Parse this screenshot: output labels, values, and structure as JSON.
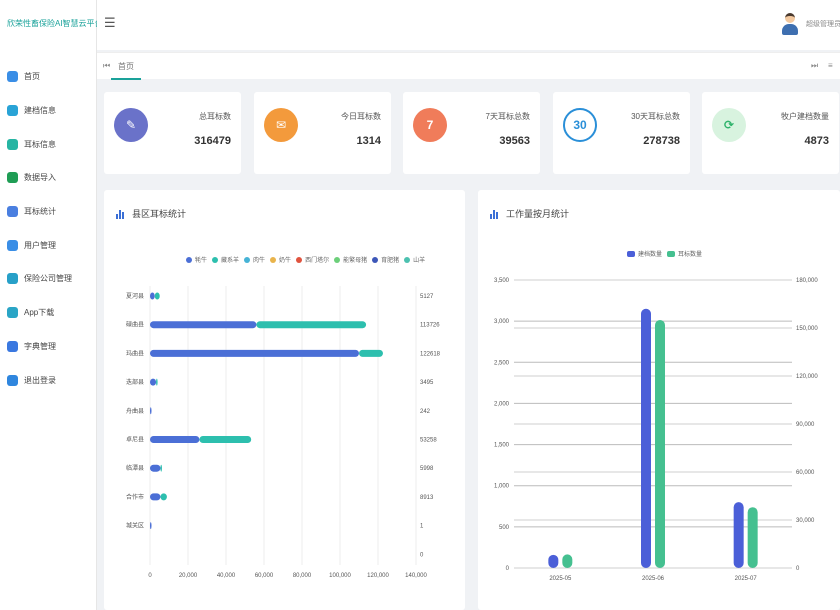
{
  "app": {
    "title": "欣荣性畜保险AI智慧云平台"
  },
  "sidebar": {
    "items": [
      {
        "label": "首页",
        "icon": "home-icon",
        "color": "#3a8ee6"
      },
      {
        "label": "建档信息",
        "icon": "file-icon",
        "color": "#29a3d6"
      },
      {
        "label": "耳标信息",
        "icon": "tag-icon",
        "color": "#27b5a3"
      },
      {
        "label": "数据导入",
        "icon": "excel-icon",
        "color": "#1f9d55"
      },
      {
        "label": "耳标统计",
        "icon": "bar-chart-icon",
        "color": "#4a7fe0"
      },
      {
        "label": "用户管理",
        "icon": "user-icon",
        "color": "#3a8ee6"
      },
      {
        "label": "保险公司管理",
        "icon": "shield-icon",
        "color": "#27a0c8"
      },
      {
        "label": "App下载",
        "icon": "app-icon",
        "color": "#2aa5c6"
      },
      {
        "label": "字典管理",
        "icon": "book-icon",
        "color": "#3a78e0"
      },
      {
        "label": "退出登录",
        "icon": "logout-icon",
        "color": "#2f86de"
      }
    ]
  },
  "header": {
    "menu_toggle": "☰",
    "user_name": "超级管理员"
  },
  "tabs": {
    "home": "首页",
    "left_arrow": "⏮",
    "right_arrow": "⏭",
    "more": "≡"
  },
  "stats": [
    {
      "label": "总耳标数",
      "value": "316479",
      "icon": "✎",
      "color": "#6a72c9",
      "ring": ""
    },
    {
      "label": "今日耳标数",
      "value": "1314",
      "icon": "✉",
      "color": "#f39a3c",
      "ring": ""
    },
    {
      "label": "7天耳标总数",
      "value": "39563",
      "icon": "7",
      "color": "#f07c5a",
      "ring": ""
    },
    {
      "label": "30天耳标总数",
      "value": "278738",
      "icon": "30",
      "color": "#ffffff",
      "ring": "#2a8fd8"
    },
    {
      "label": "牧户建档数量",
      "value": "4873",
      "icon": "⟳",
      "color": "#d8f3df",
      "ring": ""
    }
  ],
  "region_panel": {
    "title": "县区耳标统计"
  },
  "monthly_panel": {
    "title": "工作量按月统计"
  },
  "chart_data": [
    {
      "type": "bar",
      "orientation": "horizontal",
      "stacked": true,
      "categories": [
        "夏河县",
        "碌曲县",
        "玛曲县",
        "迭部县",
        "舟曲县",
        "卓尼县",
        "临潭县",
        "合作市",
        "城关区"
      ],
      "totals": [
        "5127",
        "113726",
        "122618",
        "3495",
        "242",
        "53258",
        "5998",
        "8913",
        "1",
        "0"
      ],
      "series": [
        {
          "name": "牦牛",
          "color": "#4b6fd6",
          "values": [
            2500,
            56000,
            110000,
            3200,
            242,
            26000,
            5500,
            5500,
            1
          ]
        },
        {
          "name": "藏系羊",
          "color": "#2dbfae",
          "values": [
            2627,
            57726,
            12618,
            295,
            0,
            27258,
            498,
            3413,
            0
          ]
        },
        {
          "name": "肉牛",
          "color": "#46b3d6",
          "values": [
            0,
            0,
            0,
            0,
            0,
            0,
            0,
            0,
            0
          ]
        },
        {
          "name": "奶牛",
          "color": "#e9b44c",
          "values": [
            0,
            0,
            0,
            0,
            0,
            0,
            0,
            0,
            0
          ]
        },
        {
          "name": "西门塔尔",
          "color": "#e0533e",
          "values": [
            0,
            0,
            0,
            0,
            0,
            0,
            0,
            0,
            0
          ]
        },
        {
          "name": "能繁母猪",
          "color": "#6ccf7a",
          "values": [
            0,
            0,
            0,
            0,
            0,
            0,
            0,
            0,
            0
          ]
        },
        {
          "name": "育肥猪",
          "color": "#3d57b8",
          "values": [
            0,
            0,
            0,
            0,
            0,
            0,
            0,
            0,
            0
          ]
        },
        {
          "name": "山羊",
          "color": "#4cc1b0",
          "values": [
            0,
            0,
            0,
            0,
            0,
            0,
            0,
            0,
            0
          ]
        }
      ],
      "xlim": [
        0,
        140000
      ],
      "xticks": [
        "0",
        "20,000",
        "40,000",
        "60,000",
        "80,000",
        "100,000",
        "120,000",
        "140,000"
      ],
      "legend": "top",
      "grid": true
    },
    {
      "type": "bar",
      "categories": [
        "2025-05",
        "2025-06",
        "2025-07"
      ],
      "series": [
        {
          "name": "建档数量",
          "color": "#4b5fd8",
          "axis": "left",
          "values": [
            160,
            3150,
            800
          ]
        },
        {
          "name": "耳标数量",
          "color": "#45c090",
          "axis": "right",
          "values": [
            8500,
            155000,
            38000
          ]
        }
      ],
      "ylim_left": [
        0,
        3500
      ],
      "ylim_right": [
        0,
        180000
      ],
      "yticks_left": [
        "0",
        "500",
        "1,000",
        "1,500",
        "2,000",
        "2,500",
        "3,000",
        "3,500"
      ],
      "yticks_right": [
        "0",
        "30,000",
        "60,000",
        "90,000",
        "120,000",
        "150,000",
        "180,000"
      ],
      "legend": "top",
      "grid": true
    }
  ]
}
